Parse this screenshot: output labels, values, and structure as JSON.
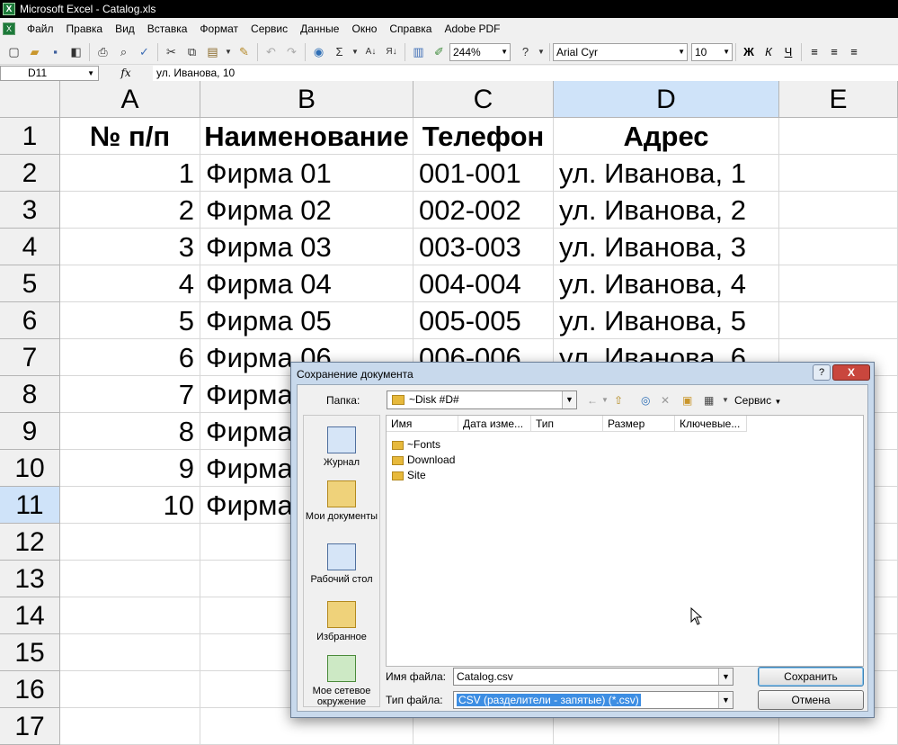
{
  "window": {
    "title": "Microsoft Excel - Catalog.xls"
  },
  "menu": [
    "Файл",
    "Правка",
    "Вид",
    "Вставка",
    "Формат",
    "Сервис",
    "Данные",
    "Окно",
    "Справка",
    "Adobe PDF"
  ],
  "toolbar": {
    "zoom": "244%",
    "font": "Arial Cyr",
    "font_size": "10"
  },
  "formula_bar": {
    "cell_ref": "D11",
    "fx": "fx",
    "content": "ул. Иванова, 10"
  },
  "grid": {
    "columns": [
      "A",
      "B",
      "C",
      "D",
      "E"
    ],
    "selected_column": "D",
    "selected_row": "11",
    "row_numbers": [
      "1",
      "2",
      "3",
      "4",
      "5",
      "6",
      "7",
      "8",
      "9",
      "10",
      "11",
      "12",
      "13",
      "14",
      "15",
      "16",
      "17"
    ],
    "header": [
      "№ п/п",
      "Наименование",
      "Телефон",
      "Адрес"
    ],
    "rows": [
      [
        "1",
        "Фирма 01",
        "001-001",
        "ул. Иванова, 1"
      ],
      [
        "2",
        "Фирма 02",
        "002-002",
        "ул. Иванова, 2"
      ],
      [
        "3",
        "Фирма 03",
        "003-003",
        "ул. Иванова, 3"
      ],
      [
        "4",
        "Фирма 04",
        "004-004",
        "ул. Иванова, 4"
      ],
      [
        "5",
        "Фирма 05",
        "005-005",
        "ул. Иванова, 5"
      ],
      [
        "6",
        "Фирма 06",
        "006-006",
        "ул. Иванова, 6"
      ],
      [
        "7",
        "Фирма",
        "",
        ""
      ],
      [
        "8",
        "Фирма",
        "",
        ""
      ],
      [
        "9",
        "Фирма",
        "",
        ""
      ],
      [
        "10",
        "Фирма",
        "",
        ""
      ]
    ]
  },
  "dialog": {
    "title": "Сохранение документа",
    "help": "?",
    "close": "X",
    "folder_label": "Папка:",
    "folder_value": "~Disk #D#",
    "tools_label": "Сервис",
    "places": [
      "Журнал",
      "Мои документы",
      "Рабочий стол",
      "Избранное",
      "Мое сетевое окружение"
    ],
    "columns": [
      "Имя",
      "Дата изме...",
      "Тип",
      "Размер",
      "Ключевые..."
    ],
    "files": [
      "~Fonts",
      "Download",
      "Site"
    ],
    "filename_label": "Имя файла:",
    "filename_value": "Catalog.csv",
    "filetype_label": "Тип файла:",
    "filetype_value": "CSV (разделители - запятые) (*.csv)",
    "save_button": "Сохранить",
    "cancel_button": "Отмена"
  }
}
